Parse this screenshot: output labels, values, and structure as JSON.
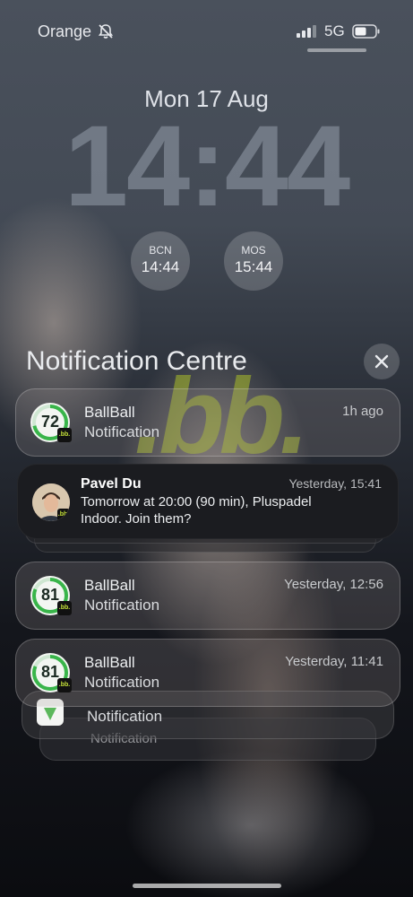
{
  "status_bar": {
    "carrier": "Orange",
    "network": "5G",
    "icons": [
      "bell-muted-icon",
      "signal-icon",
      "battery-icon"
    ]
  },
  "lock_screen": {
    "date": "Mon 17 Aug",
    "time": "14:44",
    "world_clocks": [
      {
        "city": "BCN",
        "time": "14:44"
      },
      {
        "city": "MOS",
        "time": "15:44"
      }
    ]
  },
  "notification_centre": {
    "title": "Notification Centre",
    "close_icon": "close-icon",
    "notifications": [
      {
        "app": "BallBall",
        "body": "Notification",
        "time": "1h ago",
        "score": "72"
      },
      {
        "sender": "Pavel Du",
        "body_line1": "Tomorrow at 20:00 (90 min), Pluspadel",
        "body_line2": "Indoor. Join them?",
        "time": "Yesterday, 15:41"
      },
      {
        "app": "BallBall",
        "body": "Notification",
        "time": "Yesterday, 12:56",
        "score": "81"
      },
      {
        "app": "BallBall",
        "body": "Notification",
        "time": "Yesterday, 11:41",
        "score": "81"
      }
    ],
    "stacked_below": [
      {
        "body": "Notification"
      },
      {
        "body": "Notification"
      }
    ],
    "badge_text": ".bb."
  },
  "colors": {
    "ring_green": "#39b54a",
    "badge_yellow": "#c6e23a",
    "card_dark": "#1b1c20"
  }
}
